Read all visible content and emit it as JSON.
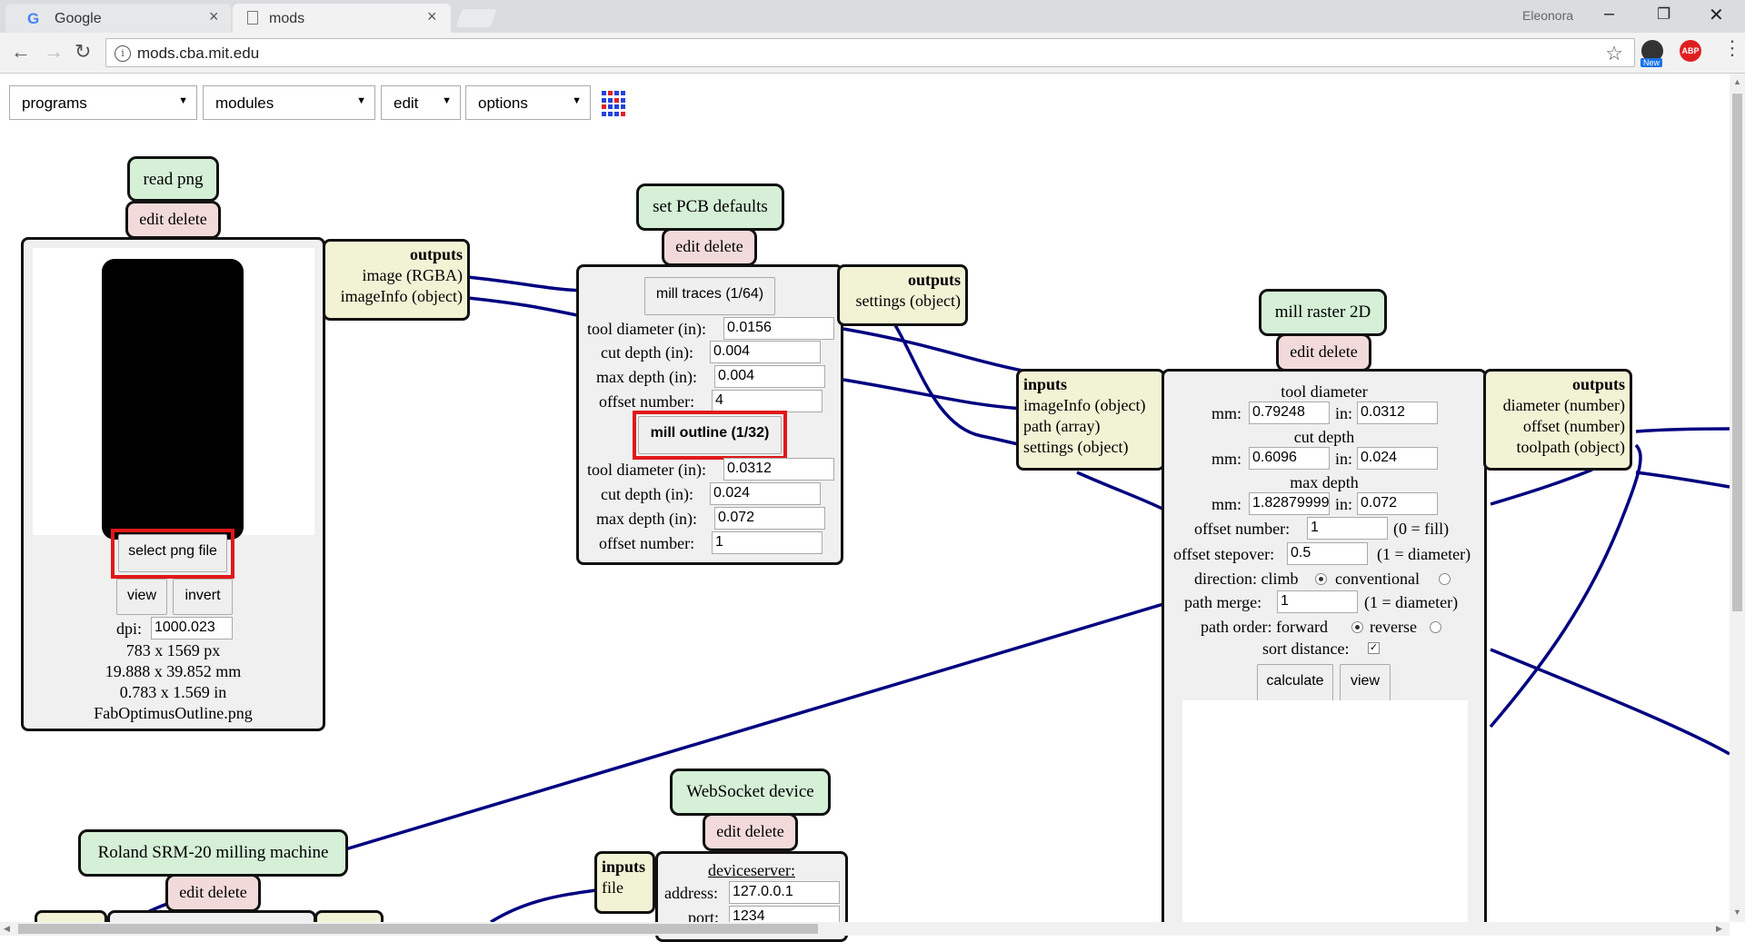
{
  "browser": {
    "tabs": [
      {
        "title": "Google",
        "active": false
      },
      {
        "title": "mods",
        "active": true
      }
    ],
    "user": "Eleonora",
    "url": "mods.cba.mit.edu",
    "extension_badge": "New",
    "abp_label": "ABP"
  },
  "menus": {
    "programs": "programs",
    "modules": "modules",
    "edit": "edit",
    "options": "options"
  },
  "read_png": {
    "title": "read png",
    "edit_delete": "edit delete",
    "select_button": "select png file",
    "view_button": "view",
    "invert_button": "invert",
    "dpi_label": "dpi:",
    "dpi_value": "1000.023",
    "size_px": "783 x 1569 px",
    "size_mm": "19.888 x 39.852 mm",
    "size_in": "0.783 x 1.569 in",
    "filename": "FabOptimusOutline.png",
    "outputs_title": "outputs",
    "outputs": [
      "image (RGBA)",
      "imageInfo (object)"
    ]
  },
  "pcb_defaults": {
    "title": "set PCB defaults",
    "edit_delete": "edit delete",
    "traces_button": "mill traces (1/64)",
    "outline_button": "mill outline (1/32)",
    "labels": {
      "tool_diameter": "tool diameter (in):",
      "cut_depth": "cut depth (in):",
      "max_depth": "max depth (in):",
      "offset_number": "offset number:"
    },
    "traces": {
      "tool_diameter": "0.0156",
      "cut_depth": "0.004",
      "max_depth": "0.004",
      "offset_number": "4"
    },
    "outline": {
      "tool_diameter": "0.0312",
      "cut_depth": "0.024",
      "max_depth": "0.072",
      "offset_number": "1"
    },
    "outputs_title": "outputs",
    "outputs": [
      "settings (object)"
    ]
  },
  "mill_raster": {
    "title": "mill raster 2D",
    "edit_delete": "edit delete",
    "inputs_title": "inputs",
    "inputs": [
      "imageInfo (object)",
      "path (array)",
      "settings (object)"
    ],
    "outputs_title": "outputs",
    "outputs": [
      "diameter (number)",
      "offset (number)",
      "toolpath (object)"
    ],
    "tool_diameter_label": "tool diameter",
    "cut_depth_label": "cut depth",
    "max_depth_label": "max depth",
    "mm_label": "mm:",
    "in_label": "in:",
    "tool_diameter_mm": "0.79248",
    "tool_diameter_in": "0.0312",
    "cut_depth_mm": "0.6096",
    "cut_depth_in": "0.024",
    "max_depth_mm": "1.82879999",
    "max_depth_in": "0.072",
    "offset_number_label": "offset number:",
    "offset_number": "1",
    "offset_number_hint": "(0 = fill)",
    "offset_stepover_label": "offset stepover:",
    "offset_stepover": "0.5",
    "offset_stepover_hint": "(1 = diameter)",
    "direction_label": "direction: climb",
    "conventional_label": "conventional",
    "path_merge_label": "path merge:",
    "path_merge": "1",
    "path_merge_hint": "(1 = diameter)",
    "path_order_label": "path order: forward",
    "reverse_label": "reverse",
    "sort_distance_label": "sort distance:",
    "calculate_button": "calculate",
    "view_button": "view"
  },
  "websocket": {
    "title": "WebSocket device",
    "edit_delete": "edit delete",
    "inputs_title": "inputs",
    "inputs": [
      "file"
    ],
    "deviceserver_label": "deviceserver:",
    "address_label": "address:",
    "address": "127.0.0.1",
    "port_label": "port:",
    "port": "1234"
  },
  "roland": {
    "title": "Roland SRM-20 milling machine",
    "edit_delete": "edit delete"
  },
  "colors": {
    "wire": "#000080",
    "module_title_bg": "#d5f0d7",
    "edit_bg": "#f3dada",
    "port_bg": "#f2f2d5",
    "highlight": "#e01818"
  }
}
